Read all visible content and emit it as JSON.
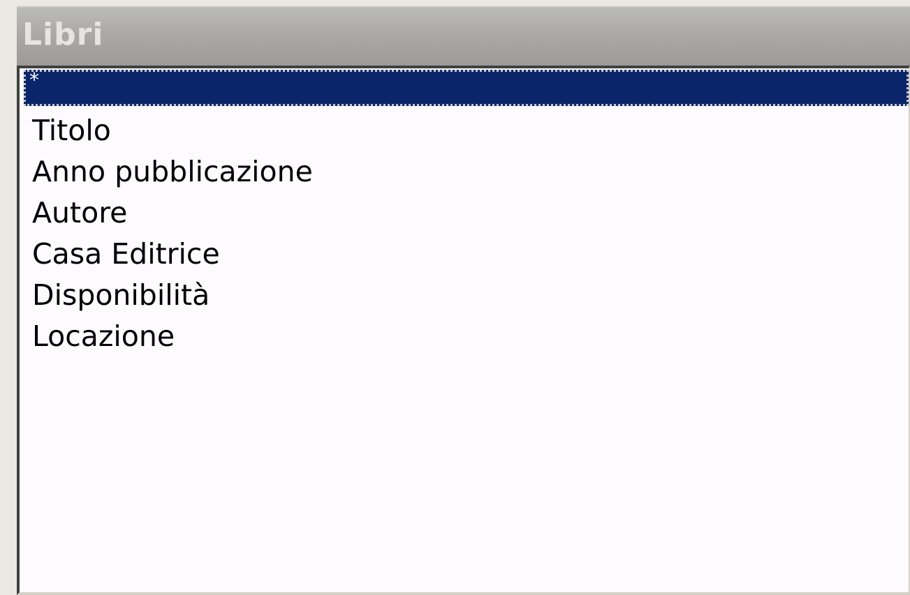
{
  "window": {
    "title": "Libri"
  },
  "field_list": {
    "items": [
      {
        "label": "*",
        "selected": true
      },
      {
        "label": "Titolo",
        "selected": false
      },
      {
        "label": "Anno pubblicazione",
        "selected": false
      },
      {
        "label": "Autore",
        "selected": false
      },
      {
        "label": "Casa Editrice",
        "selected": false
      },
      {
        "label": "Disponibilità",
        "selected": false
      },
      {
        "label": "Locazione",
        "selected": false
      }
    ]
  },
  "colors": {
    "selection": "#0a256a",
    "title_bar": "#a9a8a5",
    "list_background": "#fdfbfd"
  }
}
